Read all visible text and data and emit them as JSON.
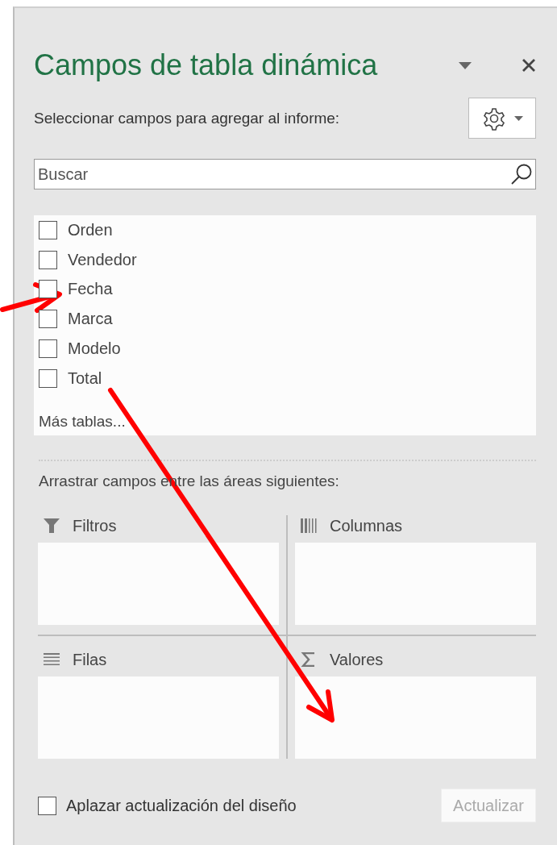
{
  "panel": {
    "title": "Campos de tabla dinámica",
    "subtitle": "Seleccionar campos para agregar al informe:"
  },
  "search": {
    "placeholder": "Buscar"
  },
  "fields": [
    {
      "label": "Orden",
      "checked": false
    },
    {
      "label": "Vendedor",
      "checked": false
    },
    {
      "label": "Fecha",
      "checked": false
    },
    {
      "label": "Marca",
      "checked": false
    },
    {
      "label": "Modelo",
      "checked": false
    },
    {
      "label": "Total",
      "checked": false
    }
  ],
  "more_tables": "Más tablas...",
  "areas_hint": "Arrastrar campos entre las áreas siguientes:",
  "areas": [
    {
      "kind": "filters",
      "label": "Filtros"
    },
    {
      "kind": "columns",
      "label": "Columnas"
    },
    {
      "kind": "rows",
      "label": "Filas"
    },
    {
      "kind": "values",
      "label": "Valores"
    }
  ],
  "defer_update": {
    "label": "Aplazar actualización del diseño",
    "checked": false
  },
  "update_button": {
    "label": "Actualizar",
    "disabled": true
  }
}
